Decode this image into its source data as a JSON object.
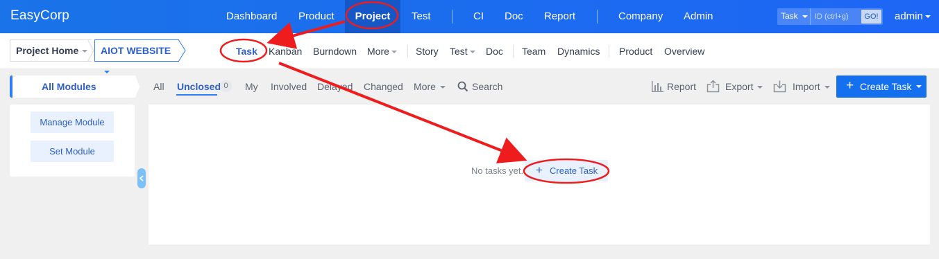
{
  "topbar": {
    "brand": "EasyCorp",
    "nav": [
      "Dashboard",
      "Product",
      "Project",
      "Test",
      "CI",
      "Doc",
      "Report",
      "Company",
      "Admin"
    ],
    "active_nav": "Project",
    "search_type": "Task",
    "search_placeholder": "ID (ctrl+g)",
    "go_label": "GO!",
    "user": "admin"
  },
  "subnav": {
    "crumb_home": "Project Home",
    "crumb_project": "AIOT WEBSITE",
    "items": [
      "Task",
      "Kanban",
      "Burndown",
      "More",
      "Story",
      "Test",
      "Doc",
      "Team",
      "Dynamics",
      "Product",
      "Overview"
    ],
    "active": "Task"
  },
  "sidebar": {
    "tab_label": "All Modules",
    "buttons": [
      "Manage Module",
      "Set Module"
    ]
  },
  "toolbar": {
    "filters": [
      "All",
      "Unclosed",
      "My",
      "Involved",
      "Delayed",
      "Changed",
      "More",
      "Search"
    ],
    "active_filter": "Unclosed",
    "unclosed_count": "0",
    "report": "Report",
    "export": "Export",
    "import": "Import",
    "create_task": "Create Task"
  },
  "empty_state": {
    "message": "No tasks yet.",
    "create_label": "Create Task"
  },
  "colors": {
    "accent": "#1570ef",
    "topbar": "#1a73e8",
    "annotation": "#ee1c1c"
  }
}
